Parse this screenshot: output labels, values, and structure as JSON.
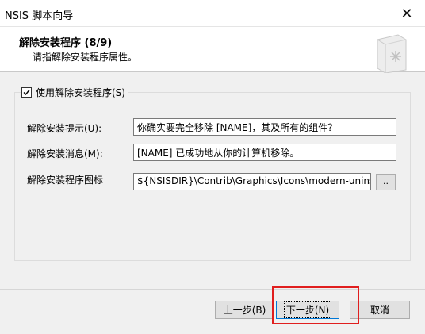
{
  "window": {
    "title": "NSIS 脚本向导",
    "close_glyph": "✕"
  },
  "header": {
    "title": "解除安装程序 (8/9)",
    "subtitle": "请指解除安装程序属性。"
  },
  "group": {
    "checkbox_label": "使用解除安装程序(S)",
    "checked": true
  },
  "fields": [
    {
      "label": "解除安装提示(U):",
      "value": "你确实要完全移除 [NAME]，其及所有的组件？"
    },
    {
      "label": "解除安装消息(M):",
      "value": "[NAME] 已成功地从你的计算机移除。"
    },
    {
      "label": "解除安装程序图标",
      "value": "${NSISDIR}\\Contrib\\Graphics\\Icons\\modern-uninstall.ico"
    }
  ],
  "browse_label": "..",
  "buttons": {
    "back": "上一步(B)",
    "next": "下一步(N)",
    "cancel": "取消"
  },
  "colors": {
    "highlight": "#e01e1e",
    "focus_border": "#0078d7"
  }
}
